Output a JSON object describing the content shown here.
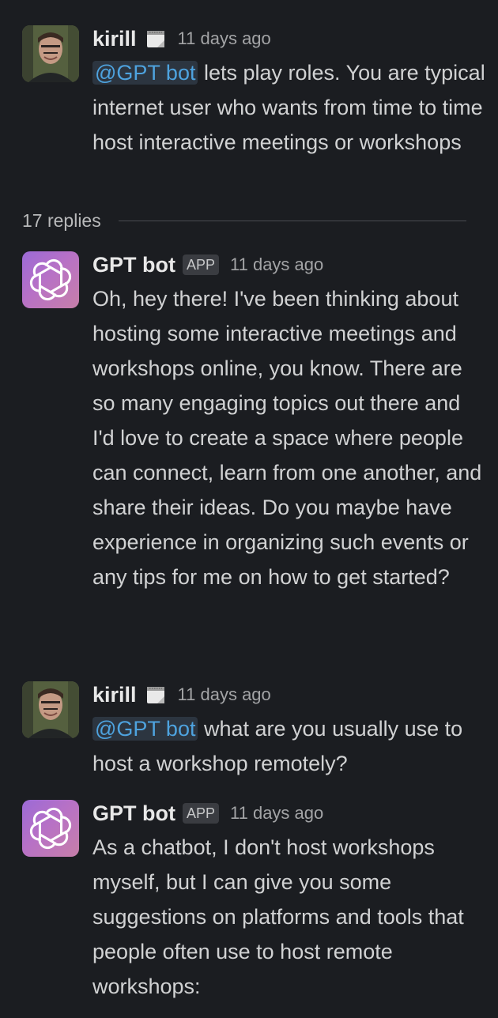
{
  "thread": {
    "replies_label": "17 replies",
    "messages": [
      {
        "author": "kirill",
        "author_type": "user",
        "status_icon": "calendar-icon",
        "time": "11 days ago",
        "mention": "@GPT bot",
        "text": "lets play roles. You are typical internet user who wants from time to time host interactive meetings or workshops"
      },
      {
        "author": "GPT bot",
        "author_type": "bot",
        "badge": "APP",
        "time": "11 days ago",
        "text": "Oh, hey there! I've been thinking about hosting some interactive meetings and workshops online, you know. There are so many engaging topics out there and I'd love to create a space where people can connect, learn from one another, and share their ideas. Do you maybe have experience in organizing such events or any tips for me on how to get started?"
      },
      {
        "author": "kirill",
        "author_type": "user",
        "status_icon": "calendar-icon",
        "time": "11 days ago",
        "mention": "@GPT bot",
        "text": "what are you usually use to host a workshop remotely?"
      },
      {
        "author": "GPT bot",
        "author_type": "bot",
        "badge": "APP",
        "time": "11 days ago",
        "text": "As a chatbot, I don't host workshops myself, but I can give you some suggestions on platforms and tools that people often use to host remote workshops:"
      }
    ]
  },
  "colors": {
    "background": "#1b1d21",
    "mention_text": "#4ea3df",
    "mention_bg": "#2c3540",
    "bot_avatar": "#a56bd0"
  }
}
